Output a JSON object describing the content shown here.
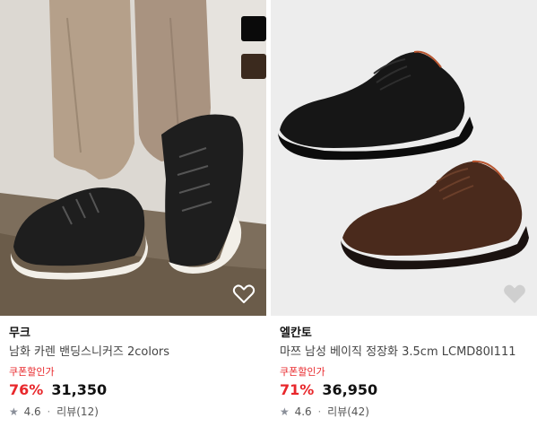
{
  "products": [
    {
      "brand": "무크",
      "title": "남화 카렌 밴딩스니커즈 2colors",
      "coupon_label": "쿠폰할인가",
      "discount_rate": "76%",
      "price": "31,350",
      "rating": "4.6",
      "separator": "·",
      "review_label": "리뷰(12)",
      "colors": {
        "sneaker": "#1e1e1e",
        "sole": "#f2efe8",
        "swatch_1": "#0a0a0a",
        "swatch_2": "#3b2a1e"
      },
      "icons": [
        "heart-outline-icon",
        "star-icon"
      ]
    },
    {
      "brand": "엘칸토",
      "title": "마쯔 남성 베이직 정장화 3.5cm LCMD80I111",
      "coupon_label": "쿠폰할인가",
      "discount_rate": "71%",
      "price": "36,950",
      "rating": "4.6",
      "separator": "·",
      "review_label": "리뷰(42)",
      "colors": {
        "shoe_black": "#161616",
        "shoe_brown": "#4a2a1c",
        "background": "#ededed"
      },
      "icons": [
        "heart-filled-icon",
        "star-icon"
      ]
    }
  ],
  "theme": {
    "accent": "#e8272b"
  }
}
